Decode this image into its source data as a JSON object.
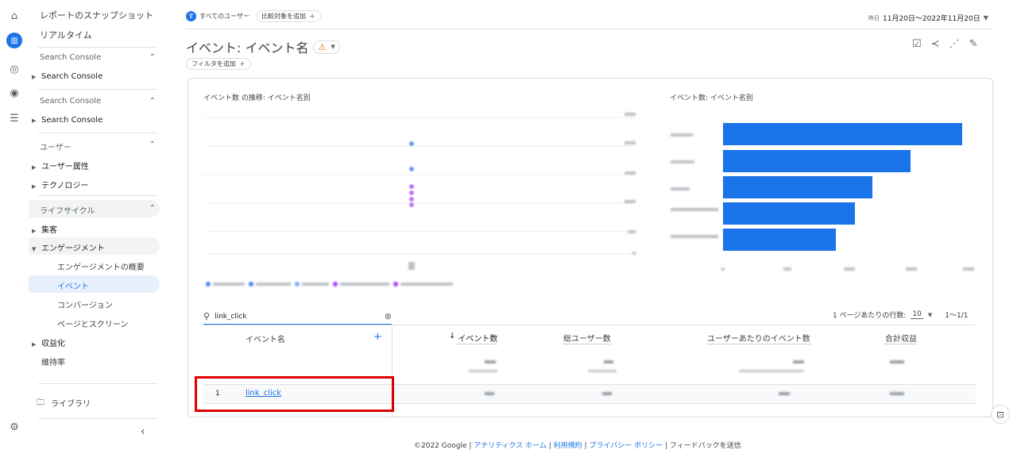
{
  "nav": {
    "reports_snapshot": "レポートのスナップショット",
    "realtime": "リアルタイム",
    "sections": [
      {
        "label": "Search Console",
        "child": "Search Console"
      },
      {
        "label": "Search Console",
        "child": "Search Console"
      },
      {
        "label": "ユーザー",
        "children": [
          "ユーザー属性",
          "テクノロジー"
        ]
      },
      {
        "label": "ライフサイクル",
        "children": [
          "集客",
          "エンゲージメント"
        ]
      }
    ],
    "engagement_items": [
      "エンゲージメントの概要",
      "イベント",
      "コンバージョン",
      "ページとスクリーン"
    ],
    "monetization": "収益化",
    "retention": "維持率",
    "library": "ライブラリ"
  },
  "header": {
    "audience_chip": "すべてのユーザー",
    "audience_initial": "す",
    "compare_chip": "比較対象を追加",
    "date_prefix": "昨日",
    "date_range": "11月20日～2022年11月20日",
    "title": "イベント: イベント名",
    "filter_chip": "フィルタを追加"
  },
  "charts": {
    "line_title": "イベント数 の推移: イベント名別",
    "bar_title": "イベント数: イベント名別"
  },
  "table": {
    "search_value": "link_click",
    "rows_per_page_label": "1 ページあたりの行数:",
    "rows_per_page": "10",
    "pagination": "1〜1/1",
    "columns": [
      "イベント名",
      "イベント数",
      "総ユーザー数",
      "ユーザーあたりのイベント数",
      "合計収益"
    ],
    "rows": [
      {
        "index": "1",
        "name": "link_click"
      }
    ]
  },
  "footer": {
    "copyright": "©2022 Google |",
    "links": [
      "アナリティクス ホーム",
      "利用規約",
      "プライバシー ポリシー"
    ],
    "feedback": "フィードバックを送信"
  },
  "colors": {
    "accent": "#1a73e8",
    "highlight_box": "#e00000",
    "warning": "#e37400"
  }
}
